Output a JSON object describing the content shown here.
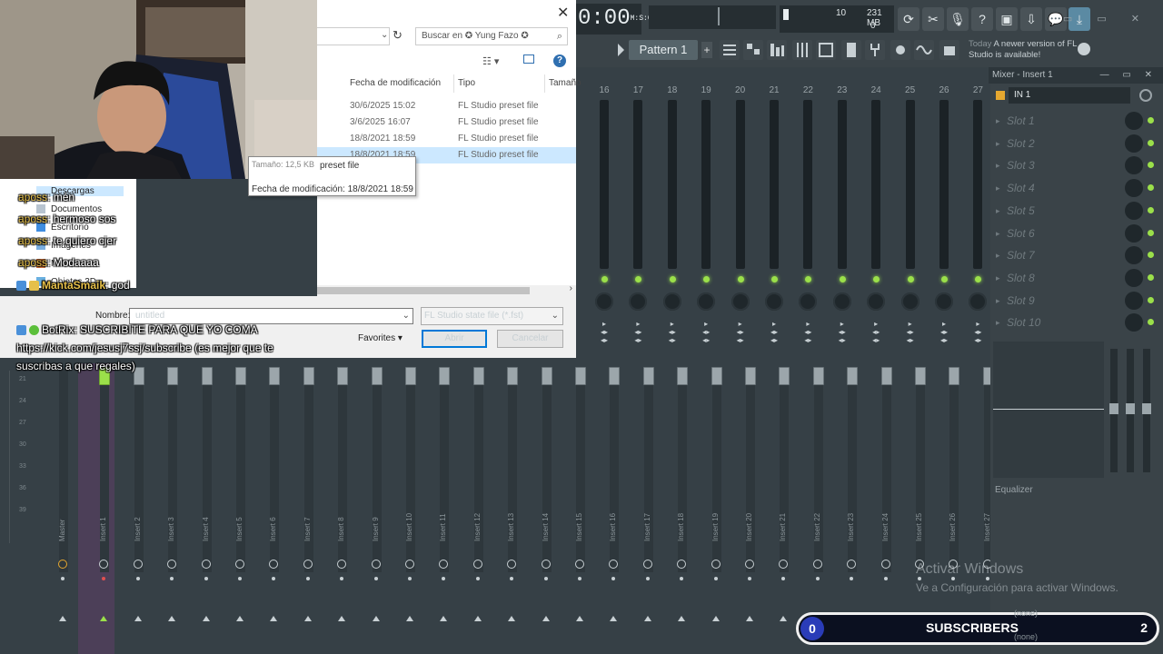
{
  "fl": {
    "time": "0:00",
    "time_small": "00",
    "time_unit": "M:S:CS",
    "cpu_value": "10",
    "mem_value": "231 MB",
    "poly_value": "0",
    "pattern_label": "Pattern 1",
    "news_date": "Today",
    "news_text": "A newer version of FL Studio is available!"
  },
  "mixer": {
    "title": "Mixer - Insert 1",
    "channel_numbers": [
      "16",
      "17",
      "18",
      "19",
      "20",
      "21",
      "22",
      "23",
      "24",
      "25",
      "26",
      "27"
    ],
    "strip_labels": [
      "Master",
      "Insert 1",
      "Insert 2",
      "Insert 3",
      "Insert 4",
      "Insert 5",
      "Insert 6",
      "Insert 7",
      "Insert 8",
      "Insert 9",
      "Insert 10",
      "Insert 11",
      "Insert 12",
      "Insert 13",
      "Insert 14",
      "Insert 15",
      "Insert 16",
      "Insert 17",
      "Insert 18",
      "Insert 19",
      "Insert 20",
      "Insert 21",
      "Insert 22",
      "Insert 23",
      "Insert 24",
      "Insert 25",
      "Insert 26",
      "Insert 27"
    ],
    "scale_ticks": [
      "21",
      "24",
      "27",
      "30",
      "33",
      "36",
      "39"
    ],
    "input": "IN 1",
    "slots": [
      "Slot 1",
      "Slot 2",
      "Slot 3",
      "Slot 4",
      "Slot 5",
      "Slot 6",
      "Slot 7",
      "Slot 8",
      "Slot 9",
      "Slot 10"
    ],
    "eq_label": "Equalizer",
    "out_none_1": "(none)",
    "out_none_2": "(none)"
  },
  "dialog": {
    "search_placeholder": "Buscar en ✪ Yung Fazo ✪",
    "col_date": "Fecha de modificación",
    "col_type": "Tipo",
    "col_size": "Tamaño",
    "rows": [
      {
        "date": "30/6/2025 15:02",
        "type": "FL Studio preset file"
      },
      {
        "date": "3/6/2025 16:07",
        "type": "FL Studio preset file"
      },
      {
        "date": "18/8/2021 18:59",
        "type": "FL Studio preset file"
      },
      {
        "date": "18/8/2021 18:59",
        "type": "FL Studio preset file"
      }
    ],
    "tooltip_size": "Tamaño: 12,5 KB",
    "tooltip_type": "preset file",
    "tooltip_date": "Fecha de modificación: 18/8/2021 18:59",
    "nav_items": [
      "Descargas",
      "Documentos",
      "Escritorio",
      "Imágenes",
      "Música",
      "Objetos 3D"
    ],
    "filename_label": "Nombre:",
    "filename_value": "untitled",
    "filetype": "FL Studio state file (*.fst)",
    "favorites": "Favorites",
    "open": "Abrir",
    "cancel": "Cancelar"
  },
  "chat": {
    "messages": [
      {
        "user": "aposs",
        "text": ": mén"
      },
      {
        "user": "aposs",
        "text": ": hermoso sos"
      },
      {
        "user": "aposs",
        "text": ": te quiero cjer"
      },
      {
        "user": "aposs",
        "text": ": Modaaaa"
      },
      {
        "user": "MantaSmaik",
        "text": ": god"
      }
    ],
    "bot_user": "BotRix",
    "bot_text": ": SUSCRIBITE PARA QUE YO COMA https://kick.com/jesusj7ssj/subscribe (es mejor que te suscribas a que regales)"
  },
  "watermark": {
    "line1": "Activar Windows",
    "line2": "Ve a Configuración para activar Windows."
  },
  "subs": {
    "count": "0",
    "label": "SUBSCRIBERS",
    "goal": "2"
  },
  "colors": {
    "fl_bg": "#364046",
    "led_green": "#9be04a",
    "insert_highlight": "#4c3f58",
    "dialog_select": "#cce8ff",
    "sub_circle": "#2a3cb8"
  }
}
